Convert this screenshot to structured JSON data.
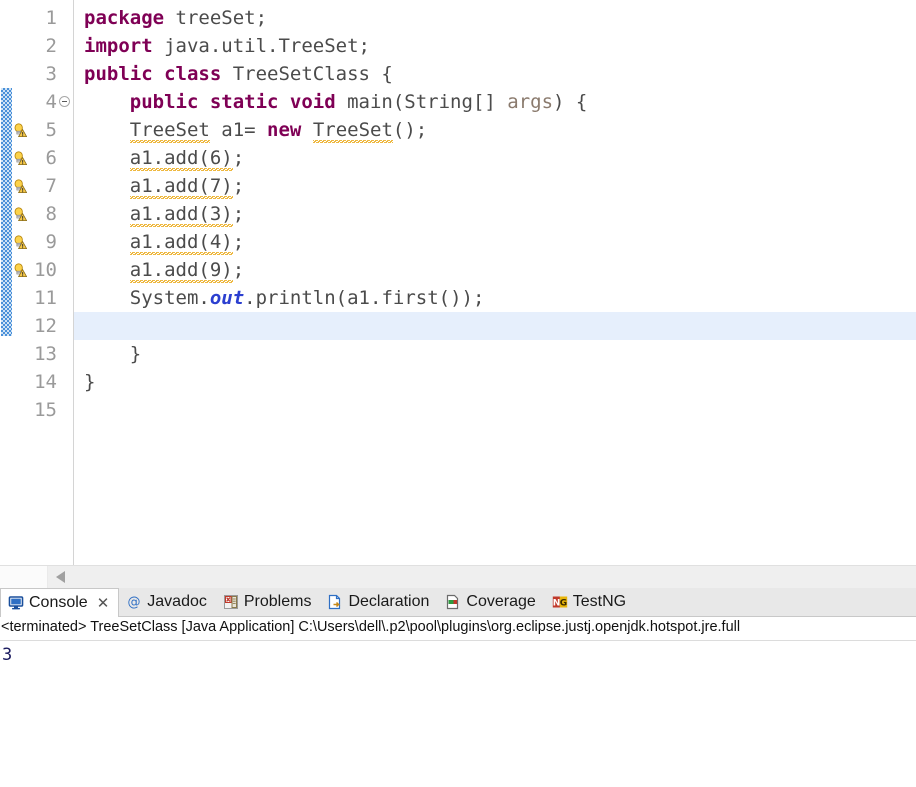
{
  "editor": {
    "first_visible_line": 1,
    "total_visible_lines": 15,
    "current_line": 12,
    "fold_line": 4,
    "warning_lines": [
      5,
      6,
      7,
      8,
      9,
      10
    ],
    "lines": [
      {
        "num": "1",
        "tokens": [
          {
            "t": "package",
            "c": "kw"
          },
          {
            "t": " treeSet;",
            "c": "pln"
          }
        ]
      },
      {
        "num": "2",
        "tokens": [
          {
            "t": "import",
            "c": "kw"
          },
          {
            "t": " java.util.TreeSet;",
            "c": "pln"
          }
        ]
      },
      {
        "num": "3",
        "tokens": [
          {
            "t": "public class",
            "c": "kw"
          },
          {
            "t": " TreeSetClass {",
            "c": "pln"
          }
        ]
      },
      {
        "num": "4",
        "tokens": [
          {
            "t": "    ",
            "c": "pln"
          },
          {
            "t": "public static void",
            "c": "kw"
          },
          {
            "t": " main(String[] ",
            "c": "pln"
          },
          {
            "t": "args",
            "c": "prm"
          },
          {
            "t": ") {",
            "c": "pln"
          }
        ]
      },
      {
        "num": "5",
        "tokens": [
          {
            "t": "    ",
            "c": "pln"
          },
          {
            "t": "TreeSet",
            "c": "pln sq"
          },
          {
            "t": " a1= ",
            "c": "pln"
          },
          {
            "t": "new",
            "c": "kw"
          },
          {
            "t": " ",
            "c": "pln"
          },
          {
            "t": "TreeSet",
            "c": "pln sq"
          },
          {
            "t": "();",
            "c": "pln"
          }
        ]
      },
      {
        "num": "6",
        "tokens": [
          {
            "t": "    ",
            "c": "pln"
          },
          {
            "t": "a1.add(6)",
            "c": "pln sq"
          },
          {
            "t": ";",
            "c": "pln"
          }
        ]
      },
      {
        "num": "7",
        "tokens": [
          {
            "t": "    ",
            "c": "pln"
          },
          {
            "t": "a1.add(7)",
            "c": "pln sq"
          },
          {
            "t": ";",
            "c": "pln"
          }
        ]
      },
      {
        "num": "8",
        "tokens": [
          {
            "t": "    ",
            "c": "pln"
          },
          {
            "t": "a1.add(3)",
            "c": "pln sq"
          },
          {
            "t": ";",
            "c": "pln"
          }
        ]
      },
      {
        "num": "9",
        "tokens": [
          {
            "t": "    ",
            "c": "pln"
          },
          {
            "t": "a1.add(4)",
            "c": "pln sq"
          },
          {
            "t": ";",
            "c": "pln"
          }
        ]
      },
      {
        "num": "10",
        "tokens": [
          {
            "t": "    ",
            "c": "pln"
          },
          {
            "t": "a1.add(9)",
            "c": "pln sq"
          },
          {
            "t": ";",
            "c": "pln"
          }
        ]
      },
      {
        "num": "11",
        "tokens": [
          {
            "t": "    System.",
            "c": "pln"
          },
          {
            "t": "out",
            "c": "fld"
          },
          {
            "t": ".println(a1.first());",
            "c": "pln"
          }
        ]
      },
      {
        "num": "12",
        "tokens": [
          {
            "t": "",
            "c": "pln"
          }
        ]
      },
      {
        "num": "13",
        "tokens": [
          {
            "t": "    }",
            "c": "pln"
          }
        ]
      },
      {
        "num": "14",
        "tokens": [
          {
            "t": "}",
            "c": "pln"
          }
        ]
      },
      {
        "num": "15",
        "tokens": [
          {
            "t": "",
            "c": "pln"
          }
        ]
      }
    ]
  },
  "scrollbar": {
    "left_arrow_icon": "triangle-left-icon"
  },
  "bottom_panel": {
    "tabs": [
      {
        "label": "Console",
        "icon": "console-monitor-icon",
        "active": true,
        "closable": true,
        "close_glyph": "✕"
      },
      {
        "label": "Javadoc",
        "icon": "javadoc-at-icon",
        "active": false,
        "closable": false
      },
      {
        "label": "Problems",
        "icon": "problems-error-icon",
        "active": false,
        "closable": false
      },
      {
        "label": "Declaration",
        "icon": "declaration-icon",
        "active": false,
        "closable": false
      },
      {
        "label": "Coverage",
        "icon": "coverage-icon",
        "active": false,
        "closable": false
      },
      {
        "label": "TestNG",
        "icon": "testng-icon",
        "active": false,
        "closable": false
      }
    ],
    "launch_status": "<terminated> TreeSetClass [Java Application] C:\\Users\\dell\\.p2\\pool\\plugins\\org.eclipse.justj.openjdk.hotspot.jre.full",
    "output": "3"
  },
  "colors": {
    "keyword": "#7f0055",
    "static_field": "#2b3fd0",
    "parameter": "#8a7a6d",
    "plain_code": "#4b4b4b",
    "current_line_highlight": "#e6effc",
    "warning_squiggle": "#e8a000",
    "change_bar": "#4a90d9",
    "console_text": "#1a1a5e",
    "tabbar_bg": "#e8e8e8"
  }
}
